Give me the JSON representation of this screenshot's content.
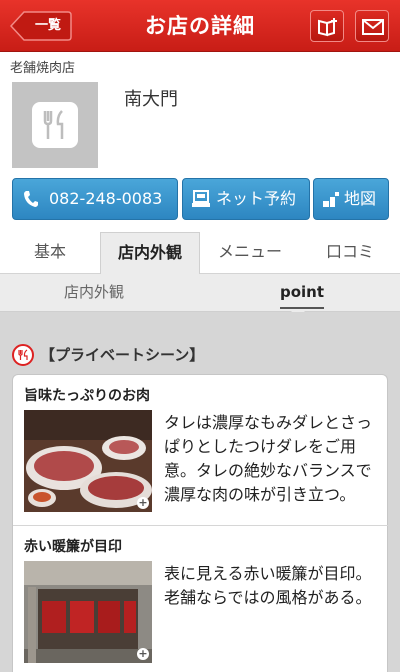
{
  "header": {
    "back_label": "一覧",
    "title": "お店の詳細",
    "bookmark_icon": "book-add-icon",
    "mail_icon": "mail-icon",
    "colors": {
      "bar": "#d8261e"
    }
  },
  "shop": {
    "category": "老舗焼肉店",
    "name": "南大門",
    "thumbnail_icon": "fork-knife-icon"
  },
  "actions": {
    "phone_label": "082-248-0083",
    "reserve_label": "ネット予約",
    "map_label": "地図",
    "colors": {
      "button": "#3b97d0"
    }
  },
  "tabs": [
    {
      "label": "基本"
    },
    {
      "label": "店内外観",
      "active": true
    },
    {
      "label": "メニュー"
    },
    {
      "label": "口コミ"
    }
  ],
  "subtabs": [
    {
      "label": "店内外観"
    },
    {
      "label": "point",
      "active": true
    }
  ],
  "section": {
    "title": "【プライベートシーン】",
    "items": [
      {
        "title": "旨味たっぷりのお肉",
        "description": "タレは濃厚なもみダレとさっぱりとしたつけダレをご用意。タレの絶妙なバランスで濃厚な肉の味が引き立つ。"
      },
      {
        "title": "赤い暖簾が目印",
        "description": "表に見える赤い暖簾が目印。老舗ならではの風格がある。"
      }
    ]
  }
}
